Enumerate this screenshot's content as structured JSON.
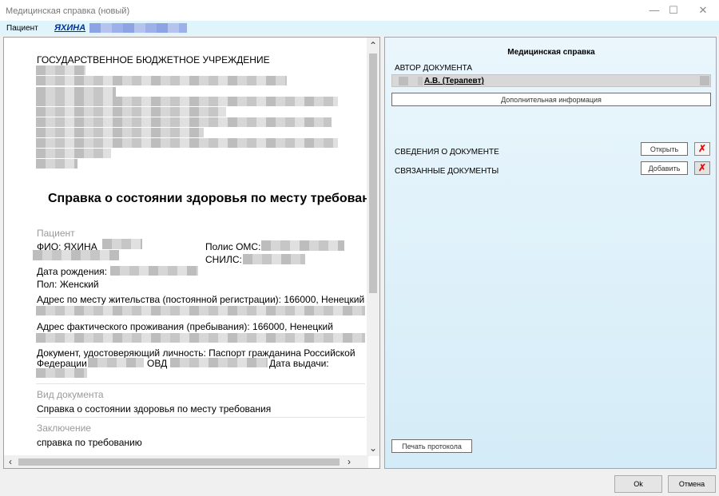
{
  "window": {
    "title": "Медицинская справка (новый)",
    "minimize": "—",
    "maximize": "☐",
    "close": "✕"
  },
  "patient_bar": {
    "label": "Пациент",
    "name": "ЯХИНА"
  },
  "document": {
    "institution": "ГОСУДАРСТВЕННОЕ БЮДЖЕТНОЕ УЧРЕЖДЕНИЕ",
    "heading": "Справка о состоянии здоровья по месту требования",
    "patient_section": "Пациент",
    "fio": "ФИО: ЯХИНА",
    "polis": "Полис ОМС:",
    "snils": "СНИЛС:",
    "birth_date": "Дата рождения:",
    "sex": "Пол: Женский",
    "reg_address": "Адрес по месту жительства (постоянной регистрации): 166000, Ненецкий",
    "fact_address": "Адрес фактического проживания (пребывания): 166000, Ненецкий",
    "identity_doc_line1": "Документ, удостоверяющий личность: Паспорт гражданина Российской",
    "identity_doc_federation": "Федерации",
    "identity_doc_ovd": "ОВД",
    "identity_doc_issue": "Дата выдачи:",
    "doc_type_label": "Вид документа",
    "doc_type_value": "Справка о состоянии здоровья по месту требования",
    "conclusion_label": "Заключение",
    "conclusion_value": "справка по требованию"
  },
  "side_panel": {
    "title": "Медицинская справка",
    "author_label": "АВТОР ДОКУМЕНТА",
    "author_name": "А.В. (Терапевт)",
    "additional_info_button": "Дополнительная информация",
    "doc_info_label": "СВЕДЕНИЯ О ДОКУМЕНТЕ",
    "open_button": "Открыть",
    "linked_docs_label": "СВЯЗАННЫЕ ДОКУМЕНТЫ",
    "add_button": "Добавить",
    "print_button": "Печать протокола"
  },
  "footer": {
    "ok_button": "Ok",
    "cancel_button": "Отмена"
  },
  "colors": {
    "link": "#003399",
    "delete_icon": "#dd1111",
    "panel_top": "#eaf6fc",
    "panel_bottom": "#d4ecf8"
  }
}
